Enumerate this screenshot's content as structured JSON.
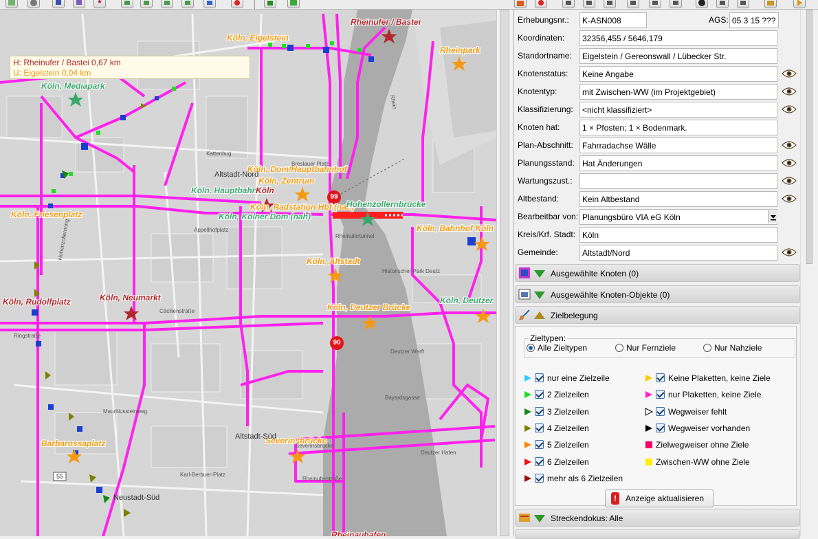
{
  "map": {
    "tooltip": {
      "line1": "H: Rheinufer / Bastei 0,67 km",
      "line2": "U: Eigelstein 0,04 km"
    },
    "labels": [
      {
        "text": "Köln, Eigelstein",
        "color": "orange"
      },
      {
        "text": "Rheinufer / Bastei",
        "color": "red"
      },
      {
        "text": "Rheinpark",
        "color": "orange"
      },
      {
        "text": "Köln, Mediapark",
        "color": "green"
      },
      {
        "text": "Köln, Dom/Hauptbahnhof",
        "color": "orange"
      },
      {
        "text": "Köln, Zentrum",
        "color": "orange"
      },
      {
        "text": "Köln, Hauptbahnhof",
        "color": "green"
      },
      {
        "text": "Köln",
        "color": "red"
      },
      {
        "text": "Köln, Radstation Hbf (nah)",
        "color": "orange"
      },
      {
        "text": "Köln, Kölner Dom (nah)",
        "color": "green"
      },
      {
        "text": "Hohenzollernbrücke",
        "color": "green"
      },
      {
        "text": "Köln, Friesenplatz",
        "color": "orange"
      },
      {
        "text": "Köln, Bahnhof Köln",
        "color": "orange"
      },
      {
        "text": "Köln, Altstadt",
        "color": "orange"
      },
      {
        "text": "Köln, Rudolfplatz",
        "color": "red"
      },
      {
        "text": "Köln, Neumarkt",
        "color": "red"
      },
      {
        "text": "Köln, Deutzer Brücke",
        "color": "orange"
      },
      {
        "text": "Köln, Deutzer",
        "color": "green"
      },
      {
        "text": "Barbarossaplatz",
        "color": "orange"
      },
      {
        "text": "Severinsbrücke",
        "color": "orange"
      },
      {
        "text": "Neustadt-Süd",
        "color": "dark"
      },
      {
        "text": "Altstadt-Süd",
        "color": "dark"
      },
      {
        "text": "Altstadt-Nord",
        "color": "dark"
      },
      {
        "text": "Rheinauhafen",
        "color": "red"
      }
    ],
    "route_badges": [
      "99",
      "90",
      "55"
    ],
    "streets": [
      "Rhein",
      "Rheinufertunnel",
      "Deutzer Werft",
      "Deutzer Hafen",
      "Historischer Park Deutz",
      "Ringstraße",
      "Cäcilienstraße",
      "Mauritiussteinweg",
      "Severinsbrücke",
      "Rheinuferstraße",
      "Karl-Berbuer-Platz",
      "Breslauer Platz",
      "Appellhofplatz",
      "Kattenbug",
      "Hohenzollernring",
      "Bayardsgasse"
    ]
  },
  "panel": {
    "fields": [
      {
        "label": "Erhebungsnr.:",
        "value": "K-ASN008",
        "eye": false
      },
      {
        "label": "Koordinaten:",
        "value": "32356,455 / 5646,179",
        "eye": false
      },
      {
        "label": "Standortname:",
        "value": "Eigelstein / Gereonswall / Lübecker Str.",
        "eye": false
      },
      {
        "label": "Knotenstatus:",
        "value": "Keine Angabe",
        "eye": true
      },
      {
        "label": "Knotentyp:",
        "value": "mit Zwischen-WW (im Projektgebiet)",
        "eye": true
      },
      {
        "label": "Klassifizierung:",
        "value": "<nicht klassifiziert>",
        "eye": true
      },
      {
        "label": "Knoten hat:",
        "value": "1 × Pfosten; 1 × Bodenmark.",
        "eye": false
      },
      {
        "label": "Plan-Abschnitt:",
        "value": "Fahrradachse Wälle",
        "eye": true
      },
      {
        "label": "Planungsstand:",
        "value": "Hat Änderungen",
        "eye": true
      },
      {
        "label": "Wartungszust.:",
        "value": "",
        "eye": true
      },
      {
        "label": "Altbestand:",
        "value": "Kein Altbestand",
        "eye": true
      },
      {
        "label": "Bearbeitbar von:",
        "value": "Planungsbüro VIA eG Köln",
        "eye": false
      },
      {
        "label": "Kreis/Krf. Stadt:",
        "value": "Köln",
        "eye": false
      },
      {
        "label": "Gemeinde:",
        "value": "Altstadt/Nord",
        "eye": true
      }
    ],
    "ags": {
      "label": "AGS:",
      "value": "05 3 15 ???"
    },
    "sections": {
      "ausgewaehlte_knoten": "Ausgewählte Knoten (0)",
      "ausgewaehlte_knoten_objekte": "Ausgewählte Knoten-Objekte (0)",
      "zielbelegung": "Zielbelegung",
      "streckendokus": "Streckendokus: Alle"
    },
    "zielbelegung": {
      "zieltypen_legend": "Zieltypen:",
      "radios": [
        {
          "label": "Alle Zieltypen",
          "selected": true
        },
        {
          "label": "Nur Fernziele",
          "selected": false
        },
        {
          "label": "Nur Nahziele",
          "selected": false
        }
      ],
      "left_items": [
        {
          "label": "nur eine Zielzeile",
          "color": "#33ccff"
        },
        {
          "label": "2 Zielzeilen",
          "color": "#22dd22"
        },
        {
          "label": "3 Zielzeilen",
          "color": "#118811"
        },
        {
          "label": "4 Zielzeilen",
          "color": "#808000"
        },
        {
          "label": "5 Zielzeilen",
          "color": "#ff8800"
        },
        {
          "label": "6 Zielzeilen",
          "color": "#ee1111"
        },
        {
          "label": "mehr als 6 Zielzeilen",
          "color": "#991111"
        }
      ],
      "right_items": [
        {
          "label": "Keine Plaketten, keine Ziele",
          "kind": "triangle",
          "color": "#ffcc00"
        },
        {
          "label": "nur Plaketten, keine Ziele",
          "kind": "triangle",
          "color": "#ff22cc"
        },
        {
          "label": "Wegweiser fehlt",
          "kind": "triangle-outline",
          "color": "#ffffff"
        },
        {
          "label": "Wegweiser vorhanden",
          "kind": "triangle",
          "color": "#000000"
        },
        {
          "label": "Zielwegweiser ohne Ziele",
          "kind": "square",
          "color": "#ff0066"
        },
        {
          "label": "Zwischen-WW ohne Ziele",
          "kind": "square",
          "color": "#ffee00"
        }
      ],
      "refresh_label": "Anzeige aktualisieren"
    }
  }
}
